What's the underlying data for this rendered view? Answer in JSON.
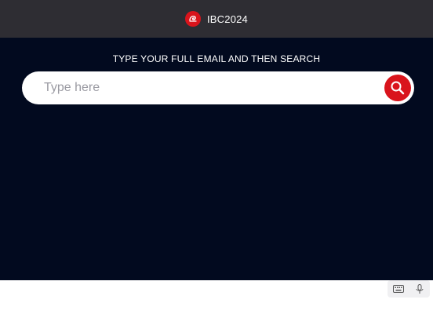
{
  "header": {
    "brand_title": "IBC2024",
    "logo_icon": "ibc-logo-icon",
    "background": "#2e2d33"
  },
  "main": {
    "instruction": "TYPE YOUR FULL EMAIL AND THEN SEARCH",
    "background": "#020a1f"
  },
  "search": {
    "placeholder": "Type here",
    "value": "",
    "button_icon": "search-icon",
    "accent": "#d9141c"
  },
  "input_tools": {
    "keyboard_icon": "keyboard-icon",
    "microphone_icon": "microphone-icon"
  }
}
